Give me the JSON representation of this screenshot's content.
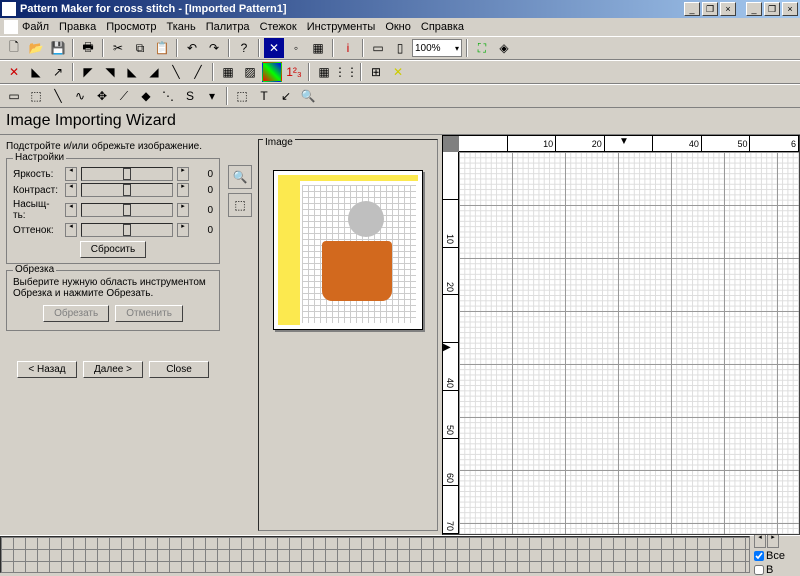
{
  "titlebar": {
    "text": "Pattern Maker for cross stitch - [Imported Pattern1]"
  },
  "menu": [
    "Файл",
    "Правка",
    "Просмотр",
    "Ткань",
    "Палитра",
    "Стежок",
    "Инструменты",
    "Окно",
    "Справка"
  ],
  "zoom": "100%",
  "wizard": {
    "title": "Image Importing Wizard"
  },
  "instruction": "Подстройте и/или обрежьте изображение.",
  "settings": {
    "legend": "Настройки",
    "brightness": {
      "label": "Яркость:",
      "value": "0"
    },
    "contrast": {
      "label": "Контраст:",
      "value": "0"
    },
    "saturation": {
      "label": "Насыщ-ть:",
      "value": "0"
    },
    "hue": {
      "label": "Оттенок:",
      "value": "0"
    },
    "reset": "Сбросить"
  },
  "crop": {
    "legend": "Обрезка",
    "hint": "Выберите нужную область инструментом Обрезка и нажмите Обрезать.",
    "crop_btn": "Обрезать",
    "cancel_btn": "Отменить"
  },
  "nav": {
    "back": "< Назад",
    "next": "Далее >",
    "close": "Close"
  },
  "image_label": "Image",
  "ruler_h": [
    "",
    "10",
    "20",
    "",
    "40",
    "50",
    "6"
  ],
  "ruler_h_marker": "30",
  "ruler_v": [
    "",
    "10",
    "20",
    "",
    "40",
    "50",
    "60",
    "70"
  ],
  "ruler_v_marker": "30",
  "palette_ctrl": {
    "all": "Все",
    "label_b": "B"
  }
}
